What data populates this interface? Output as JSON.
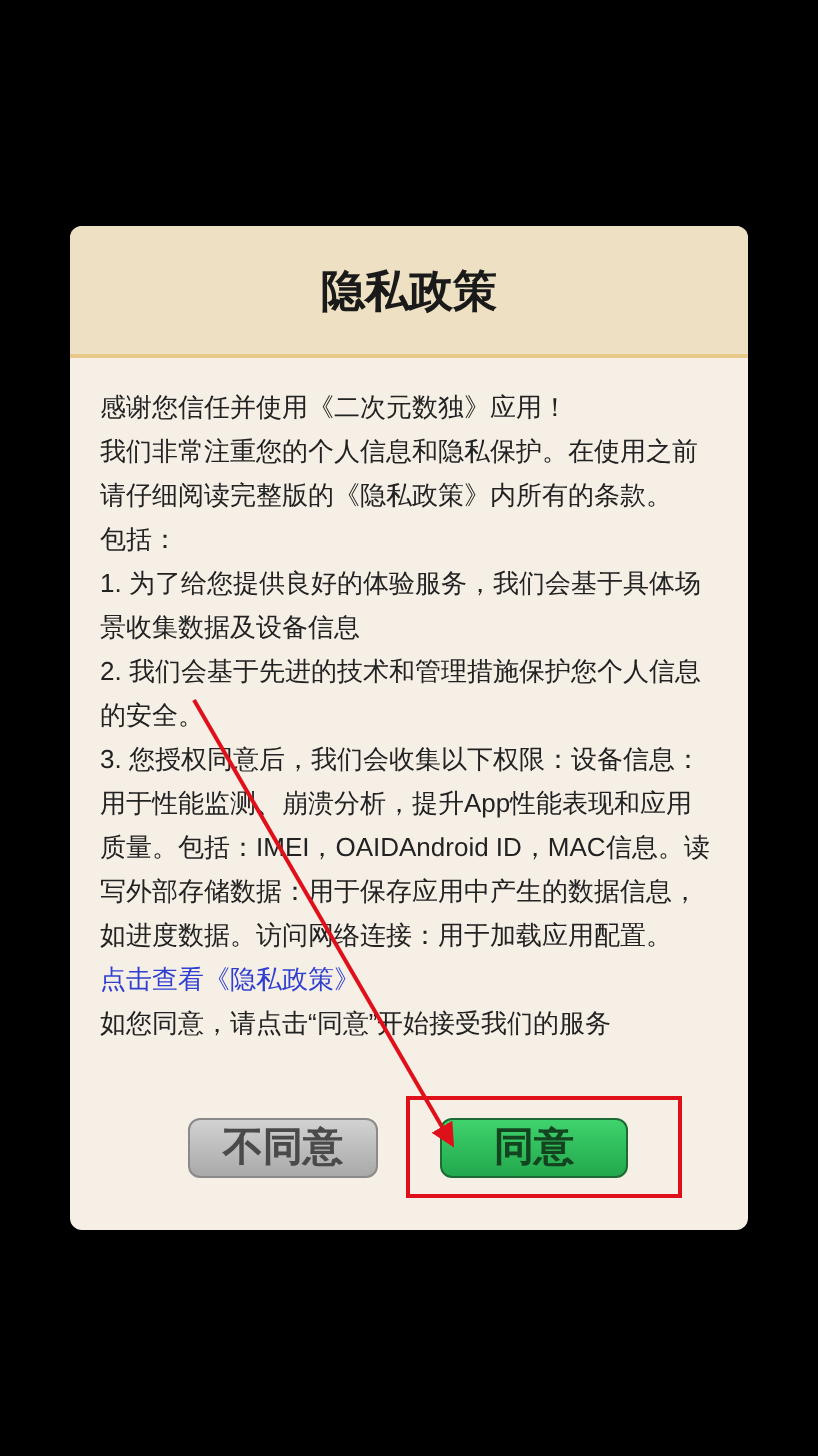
{
  "dialog": {
    "title": "隐私政策",
    "paragraphs": [
      {
        "kind": "text",
        "text": "感谢您信任并使用《二次元数独》应用！"
      },
      {
        "kind": "text",
        "text": "我们非常注重您的个人信息和隐私保护。在使用之前请仔细阅读完整版的《隐私政策》内所有的条款。"
      },
      {
        "kind": "text",
        "text": "包括："
      },
      {
        "kind": "text",
        "text": "1. 为了给您提供良好的体验服务，我们会基于具体场景收集数据及设备信息"
      },
      {
        "kind": "text",
        "text": "2. 我们会基于先进的技术和管理措施保护您个人信息的安全。"
      },
      {
        "kind": "text",
        "text": "3. 您授权同意后，我们会收集以下权限：设备信息：用于性能监测、崩溃分析，提升App性能表现和应用质量。包括：IMEI，OAIDAndroid ID，MAC信息。读写外部存储数据：用于保存应用中产生的数据信息，如进度数据。访问网络连接：用于加载应用配置。"
      },
      {
        "kind": "link",
        "text": "点击查看《隐私政策》"
      },
      {
        "kind": "text",
        "text": "如您同意，请点击“同意”开始接受我们的服务"
      }
    ],
    "buttons": [
      {
        "kind": "decline",
        "label": "不同意"
      },
      {
        "kind": "accept",
        "label": "同意"
      }
    ]
  }
}
